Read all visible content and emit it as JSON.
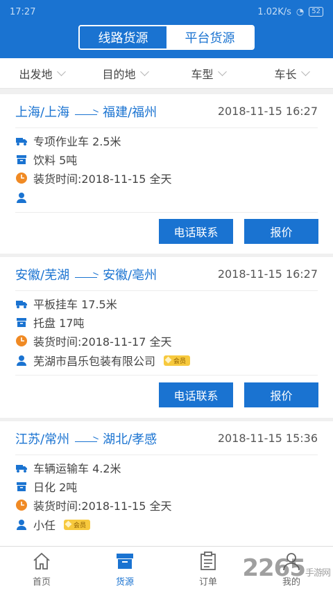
{
  "status_bar": {
    "time": "17:27",
    "network": "1.02K/s",
    "battery": "52"
  },
  "segment": {
    "left": "线路货源",
    "right": "平台货源"
  },
  "filters": [
    "出发地",
    "目的地",
    "车型",
    "车长"
  ],
  "buttons": {
    "call": "电话联系",
    "quote": "报价"
  },
  "listings": [
    {
      "from": "上海/上海",
      "to": "福建/福州",
      "time": "2018-11-15 16:27",
      "vehicle": "专项作业车 2.5米",
      "cargo": "饮料 5吨",
      "loading": "装货时间:2018-11-15 全天",
      "shipper": "",
      "member_badge": ""
    },
    {
      "from": "安徽/芜湖",
      "to": "安徽/亳州",
      "time": "2018-11-15 16:27",
      "vehicle": "平板挂车 17.5米",
      "cargo": "托盘 17吨",
      "loading": "装货时间:2018-11-17 全天",
      "shipper": "芜湖市昌乐包装有限公司",
      "member_badge": "会员"
    },
    {
      "from": "江苏/常州",
      "to": "湖北/孝感",
      "time": "2018-11-15 15:36",
      "vehicle": "车辆运输车 4.2米",
      "cargo": "日化 2吨",
      "loading": "装货时间:2018-11-15 全天",
      "shipper": "小任",
      "member_badge": "会员"
    }
  ],
  "tabs": [
    "首页",
    "货源",
    "订单",
    "我的"
  ],
  "watermark": {
    "brand": "2265",
    "sub": "手游网"
  },
  "colors": {
    "primary": "#1a73d1",
    "clock": "#f08a24",
    "badge": "#f7c93d"
  }
}
